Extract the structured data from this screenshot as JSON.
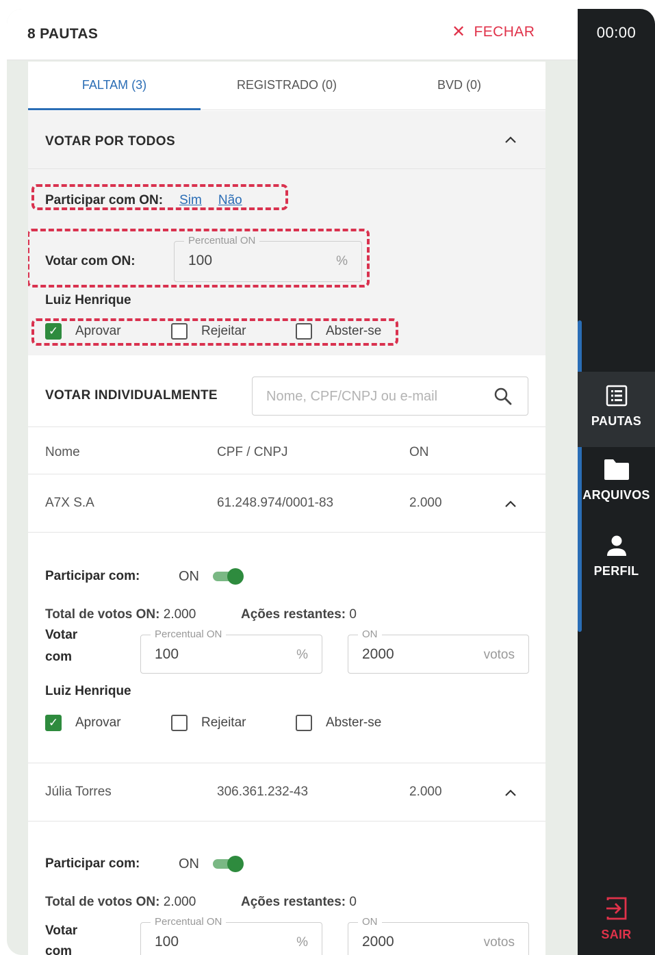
{
  "header": {
    "title": "8 PAUTAS",
    "close_label": "FECHAR"
  },
  "tabs": [
    {
      "label": "FALTAM (3)",
      "active": true
    },
    {
      "label": "REGISTRADO (0)",
      "active": false
    },
    {
      "label": "BVD (0)",
      "active": false
    }
  ],
  "vote_all": {
    "title": "VOTAR POR TODOS",
    "participar_label": "Participar com ON:",
    "sim": "Sim",
    "nao": "Não",
    "votar_label": "Votar com ON:",
    "percent_legend": "Percentual ON",
    "percent_value": "100",
    "percent_suffix": "%",
    "person": "Luiz Henrique",
    "options": [
      "Aprovar",
      "Rejeitar",
      "Abster-se"
    ],
    "selected": "Aprovar"
  },
  "individual": {
    "title": "VOTAR INDIVIDUALMENTE",
    "search_placeholder": "Nome, CPF/CNPJ ou e-mail",
    "columns": [
      "Nome",
      "CPF / CNPJ",
      "ON"
    ],
    "rows": [
      {
        "name": "A7X S.A",
        "doc": "61.248.974/0001-83",
        "on": "2.000",
        "participar_label": "Participar com:",
        "participar_value": "ON",
        "total_label": "Total de votos ON:",
        "total_value": "2.000",
        "restantes_label": "Ações restantes:",
        "restantes_value": "0",
        "votar_label_1": "Votar",
        "votar_label_2": "com",
        "percent_legend": "Percentual ON",
        "percent_value": "100",
        "percent_suffix": "%",
        "on_legend": "ON",
        "on_value": "2000",
        "on_suffix": "votos",
        "person": "Luiz Henrique",
        "options": [
          "Aprovar",
          "Rejeitar",
          "Abster-se"
        ]
      },
      {
        "name": "Júlia Torres",
        "doc": "306.361.232-43",
        "on": "2.000",
        "participar_label": "Participar com:",
        "participar_value": "ON",
        "total_label": "Total de votos ON:",
        "total_value": "2.000",
        "restantes_label": "Ações restantes:",
        "restantes_value": "0",
        "votar_label_1": "Votar",
        "votar_label_2": "com",
        "percent_legend": "Percentual ON",
        "percent_value": "100",
        "percent_suffix": "%",
        "on_legend": "ON",
        "on_value": "2000",
        "on_suffix": "votos"
      }
    ]
  },
  "sidebar": {
    "timer": "00:00",
    "items": [
      {
        "label": "PAUTAS",
        "icon": "list-icon",
        "active": true
      },
      {
        "label": "ARQUIVOS",
        "icon": "folder-icon",
        "active": false
      },
      {
        "label": "PERFIL",
        "icon": "person-icon",
        "active": false
      }
    ],
    "logout_label": "SAIR"
  },
  "colors": {
    "accent": "#2a6db5",
    "danger": "#e0324a",
    "success": "#2e8b3e",
    "sidebar_bg": "#1c1f21"
  }
}
